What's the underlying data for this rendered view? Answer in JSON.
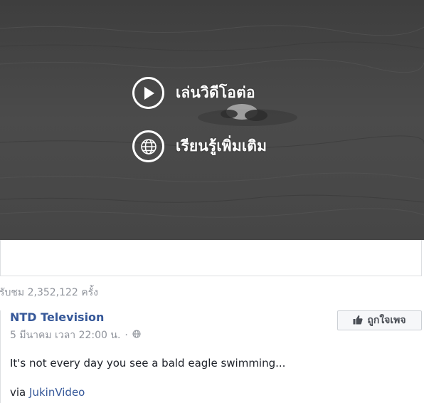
{
  "video": {
    "actions": [
      {
        "label": "เล่นวิดีโอต่อ",
        "icon": "play-icon"
      },
      {
        "label": "เรียนรู้เพิ่มเติม",
        "icon": "globe-icon"
      }
    ]
  },
  "stats": {
    "view_count": "รับชม 2,352,122 ครั้ง"
  },
  "post": {
    "page_name": "NTD Television",
    "timestamp": "5 มีนาคม เวลา 22:00 น.",
    "separator": "·",
    "privacy_icon": "globe-icon",
    "like_label": "ถูกใจเพจ",
    "like_icon": "thumbs-up-icon",
    "text": "It's not every day you see a bald eagle swimming...",
    "via_prefix": "via",
    "via_link": "JukinVideo"
  },
  "colors": {
    "link": "#365899",
    "muted": "#90949c",
    "body_text": "#1d2129",
    "video_bg": "#4a4a4a"
  }
}
